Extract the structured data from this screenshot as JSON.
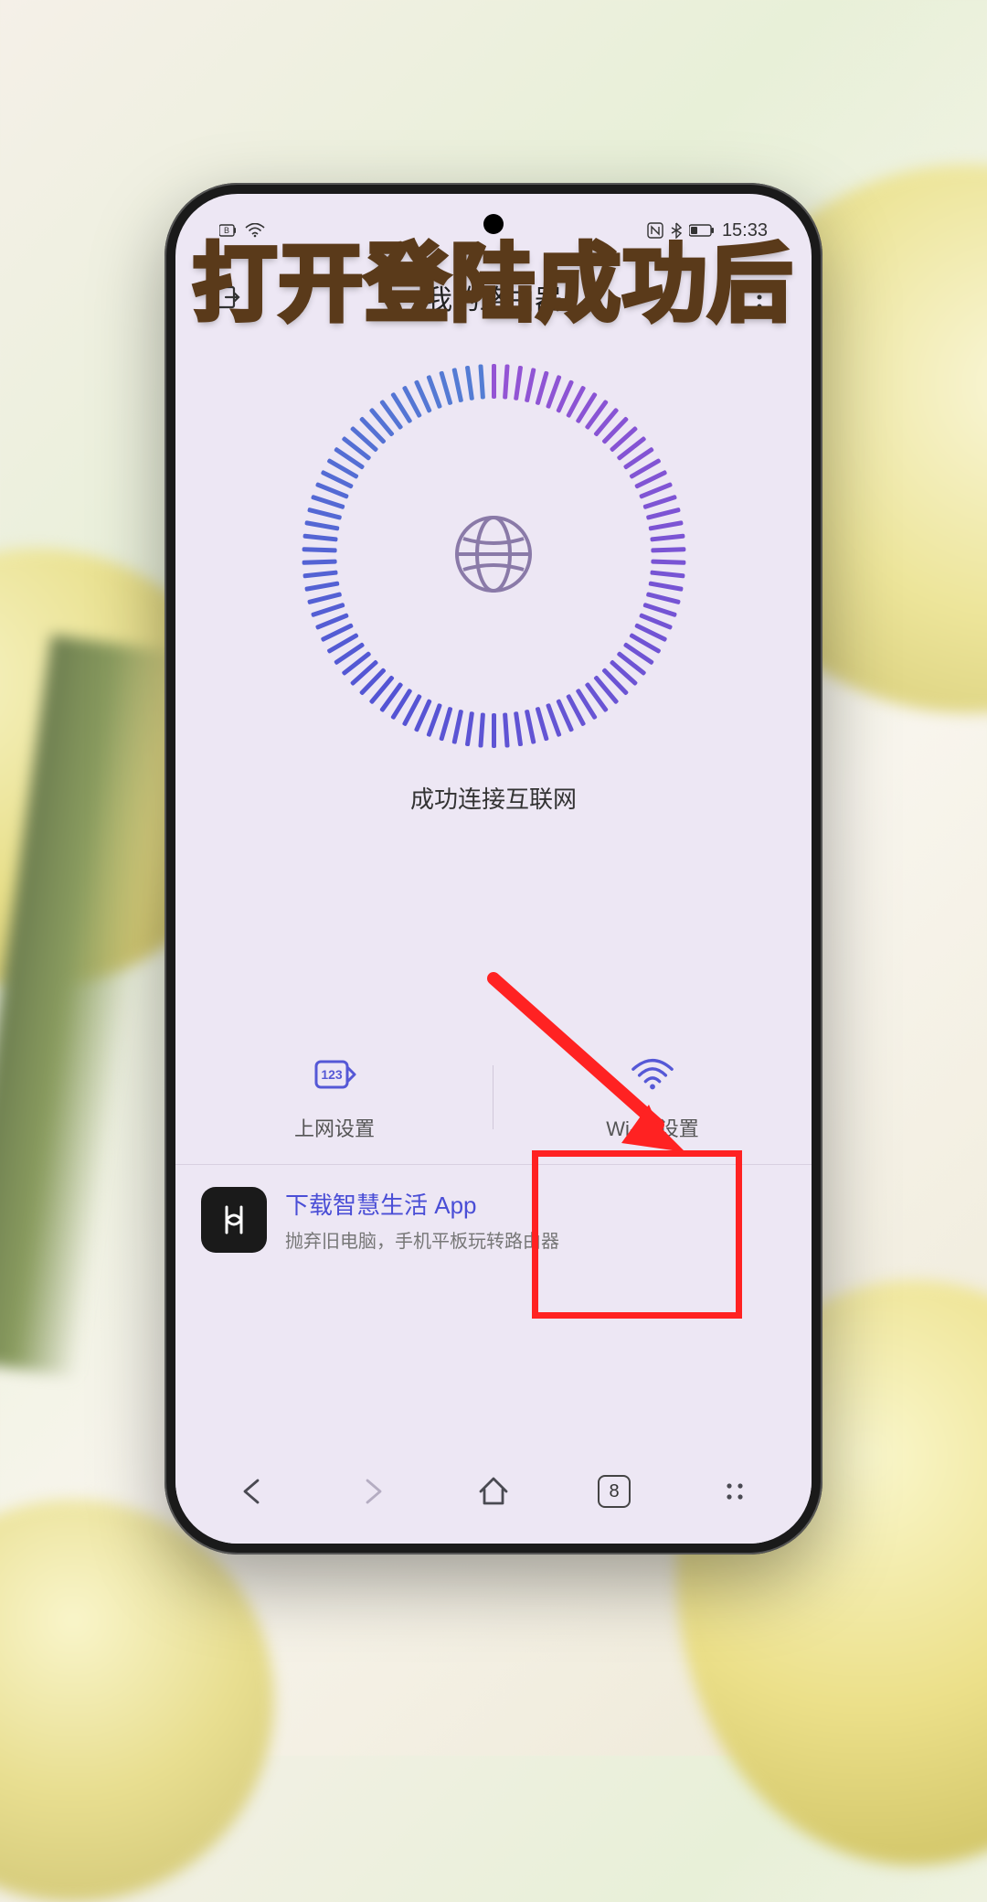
{
  "caption": "打开登陆成功后",
  "statusbar": {
    "time": "15:33"
  },
  "header": {
    "title": "我的路由器"
  },
  "connection": {
    "status_text": "成功连接互联网"
  },
  "options": {
    "internet": {
      "label": "上网设置"
    },
    "wifi": {
      "label": "Wi-Fi 设置"
    }
  },
  "promo": {
    "title": "下载智慧生活 App",
    "subtitle": "抛弃旧电脑，手机平板玩转路由器"
  },
  "browser": {
    "tab_count": "8"
  }
}
